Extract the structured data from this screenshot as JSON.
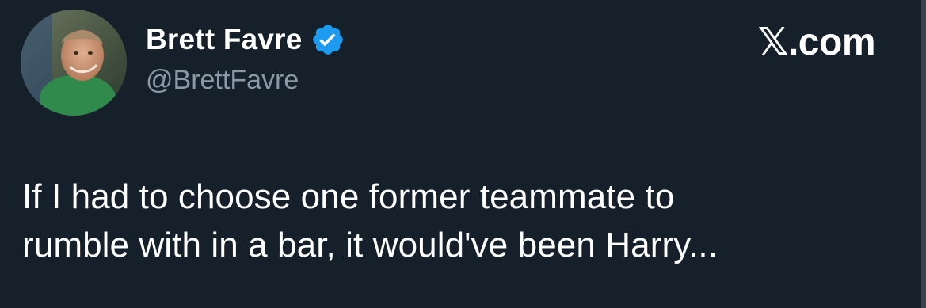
{
  "author": {
    "display_name": "Brett Favre",
    "handle": "@BrettFavre",
    "verified_icon": "verified-badge-icon",
    "avatar_icon": "profile-avatar"
  },
  "site": {
    "label": "𝕏.com"
  },
  "tweet": {
    "lines": [
      "If I had to choose one former teammate to",
      "rumble with in a bar, it would've been Harry..."
    ]
  },
  "colors": {
    "background": "#15202b",
    "text": "#ffffff",
    "secondary_text": "#8b98a5",
    "verified_blue": "#1d9bf0"
  }
}
